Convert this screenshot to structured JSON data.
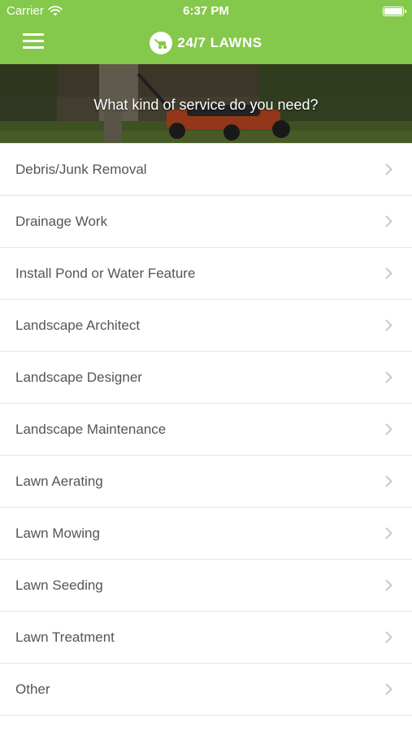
{
  "status_bar": {
    "carrier": "Carrier",
    "time": "6:37 PM",
    "battery_level": 1.0
  },
  "header": {
    "brand_name": "24/7 LAWNS",
    "menu_icon": "hamburger-menu-icon",
    "logo_icon": "lawn-mower-icon"
  },
  "hero": {
    "title": "What kind of service do you need?"
  },
  "services": [
    {
      "label": "Debris/Junk Removal"
    },
    {
      "label": "Drainage Work"
    },
    {
      "label": "Install Pond or Water Feature"
    },
    {
      "label": "Landscape Architect"
    },
    {
      "label": "Landscape Designer"
    },
    {
      "label": "Landscape Maintenance"
    },
    {
      "label": "Lawn Aerating"
    },
    {
      "label": "Lawn Mowing"
    },
    {
      "label": "Lawn Seeding"
    },
    {
      "label": "Lawn Treatment"
    },
    {
      "label": "Other"
    },
    {
      "label": ""
    }
  ],
  "colors": {
    "brand_green": "#84c94b",
    "text_gray": "#555555",
    "divider": "#e3e3e3",
    "chevron": "#c7c7cc"
  }
}
